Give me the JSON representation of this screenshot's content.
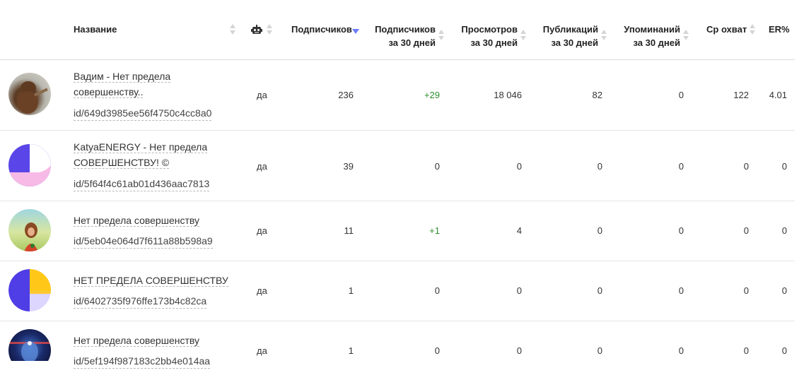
{
  "columns": {
    "name": "Название",
    "subscribers": "Подписчиков",
    "subs30_l1": "Подписчиков",
    "subs30_l2": "за 30 дней",
    "views30_l1": "Просмотров",
    "views30_l2": "за 30 дней",
    "posts30_l1": "Публикаций",
    "posts30_l2": "за 30 дней",
    "mentions30_l1": "Упоминаний",
    "mentions30_l2": "за 30 дней",
    "reach": "Ср охват",
    "er": "ER%"
  },
  "rows": [
    {
      "name_l1": "Вадим - Нет предела",
      "name_l2": "совершенству..",
      "id": "id/649d3985ee56f4750c4cc8a0",
      "bot": "да",
      "subscribers": "236",
      "subs30": "+29",
      "views30": "18 046",
      "posts30": "82",
      "mentions30": "0",
      "reach": "122",
      "er": "4.01"
    },
    {
      "name_l1": "KatyaENERGY - Нет предела",
      "name_l2": "СОВЕРШЕНСТВУ! ©",
      "id": "id/5f64f4c61ab01d436aac7813",
      "bot": "да",
      "subscribers": "39",
      "subs30": "0",
      "views30": "0",
      "posts30": "0",
      "mentions30": "0",
      "reach": "0",
      "er": "0"
    },
    {
      "name_l1": "Нет предела совершенству",
      "id": "id/5eb04e064d7f611a88b598a9",
      "bot": "да",
      "subscribers": "11",
      "subs30": "+1",
      "views30": "4",
      "posts30": "0",
      "mentions30": "0",
      "reach": "0",
      "er": "0"
    },
    {
      "name_l1": "НЕТ ПРЕДЕЛА СОВЕРШЕНСТВУ",
      "id": "id/6402735f976ffe173b4c82ca",
      "bot": "да",
      "subscribers": "1",
      "subs30": "0",
      "views30": "0",
      "posts30": "0",
      "mentions30": "0",
      "reach": "0",
      "er": "0"
    },
    {
      "name_l1": "Нет предела совершенству",
      "id": "id/5ef194f987183c2bb4e014aa",
      "bot": "да",
      "subscribers": "1",
      "subs30": "0",
      "views30": "0",
      "posts30": "0",
      "mentions30": "0",
      "reach": "0",
      "er": "0"
    }
  ],
  "colors": {
    "positive": "#2e8b2e",
    "sort_active": "#6b7cff",
    "sort_inactive": "#d5d5d5"
  }
}
